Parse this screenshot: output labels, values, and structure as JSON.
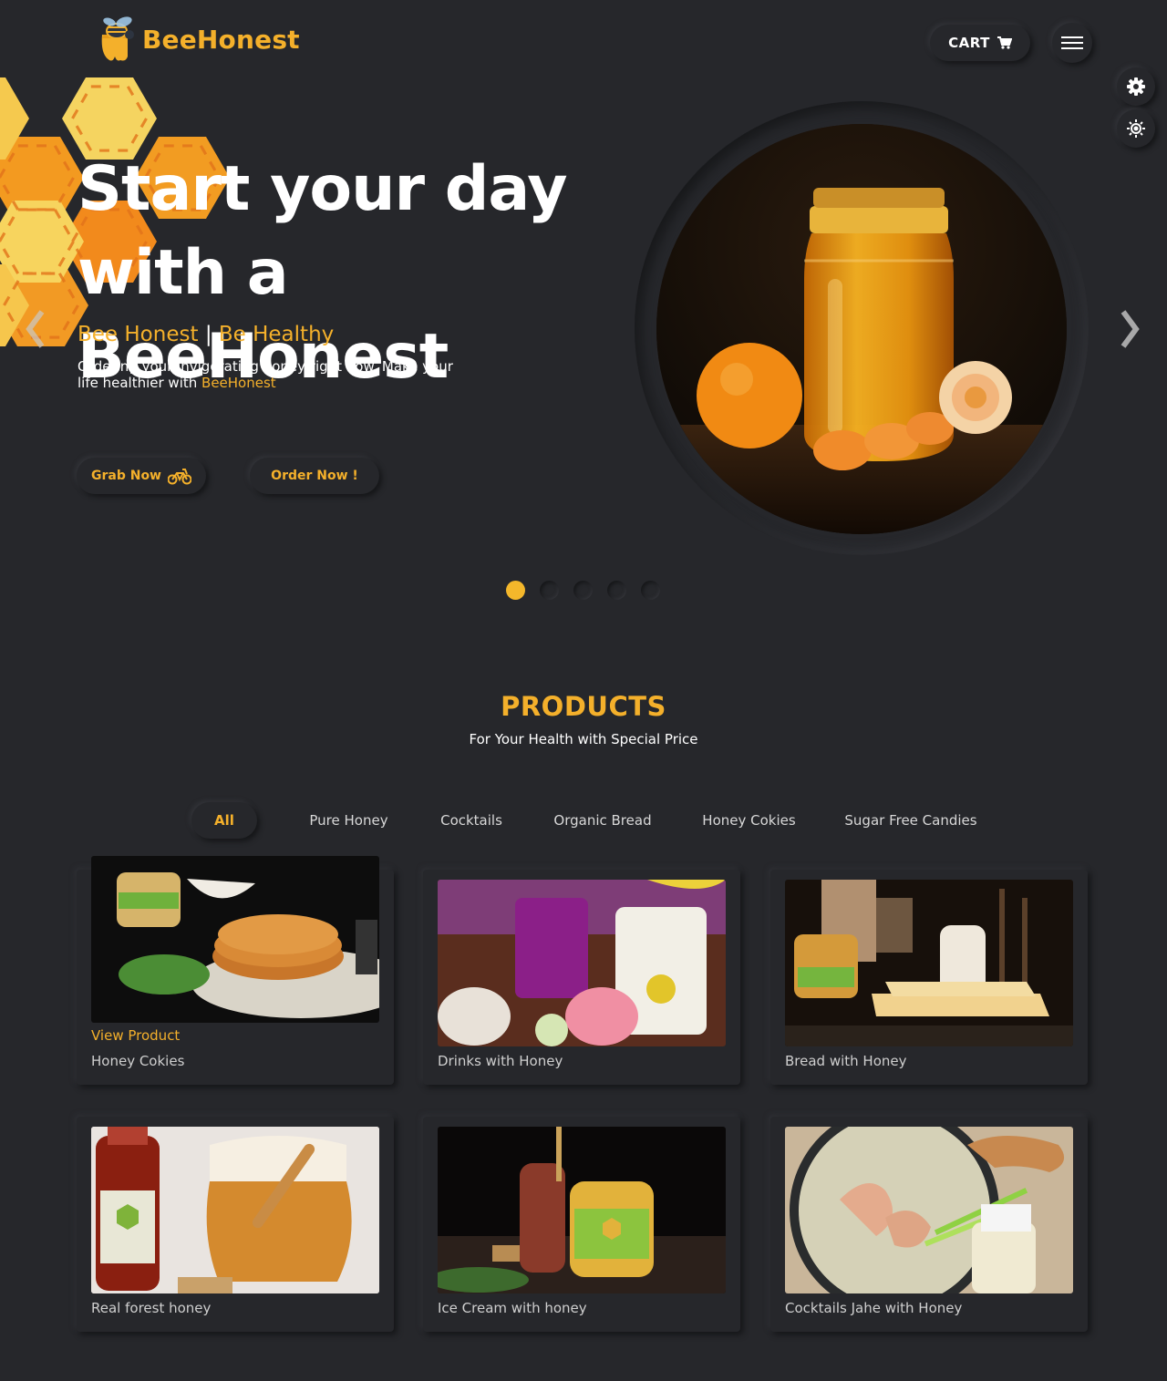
{
  "brand": {
    "name": "BeeHonest",
    "accent": "#f4b02b"
  },
  "header": {
    "cart_label": "CART",
    "cart_icon": "shopping-cart-icon",
    "menu_icon": "hamburger-menu-icon",
    "settings_icon": "gear-icon",
    "theme_icon": "sun-brightness-icon"
  },
  "hero": {
    "title_line1": "Start your day",
    "title_line2": "with a BeeHonest",
    "sub_left": "Bee Honest",
    "sub_sep": "|",
    "sub_right": "Be Healthy",
    "desc_text": "Ordering your invigorating honey right now. Make your life healthier with",
    "desc_brand": "BeeHonest",
    "grab_label": "Grab Now",
    "order_label": "Order Now !",
    "slide_count": 5,
    "active_slide": 1
  },
  "products": {
    "title": "PRODUCTS",
    "subtitle": "For Your Health with Special Price",
    "filters": [
      "All",
      "Pure Honey",
      "Cocktails",
      "Organic Bread",
      "Honey Cokies",
      "Sugar Free Candies"
    ],
    "active_filter": "All",
    "view_label": "View Product",
    "items": [
      {
        "name": "Honey Cokies"
      },
      {
        "name": "Drinks with Honey"
      },
      {
        "name": "Bread with Honey"
      },
      {
        "name": "Real forest honey"
      },
      {
        "name": "Ice Cream with honey"
      },
      {
        "name": "Cocktails Jahe with Honey"
      }
    ]
  }
}
